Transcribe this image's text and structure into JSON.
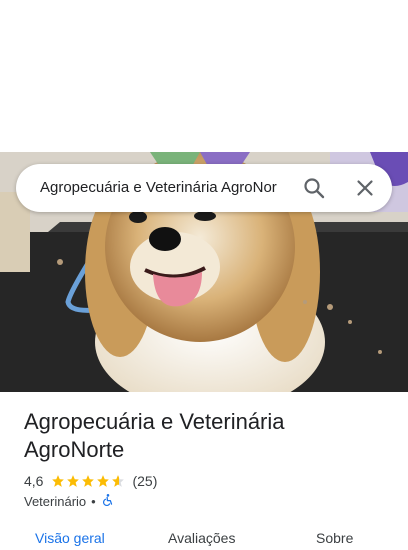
{
  "search": {
    "query": "Agropecuária e Veterinária AgroNor"
  },
  "place": {
    "name": "Agropecuária e Veterinária AgroNorte",
    "rating": "4,6",
    "stars": 4.6,
    "review_count": "(25)",
    "category": "Veterinário",
    "separator": "•"
  },
  "tabs": [
    {
      "label": "Visão geral",
      "active": true
    },
    {
      "label": "Avaliações",
      "active": false
    },
    {
      "label": "Sobre",
      "active": false
    }
  ],
  "colors": {
    "accent": "#1a73e8",
    "star": "#fbbc04",
    "accessibility": "#1a73e8"
  },
  "icons": {
    "search": "search-icon",
    "close": "close-icon",
    "accessible": "wheelchair-icon"
  }
}
